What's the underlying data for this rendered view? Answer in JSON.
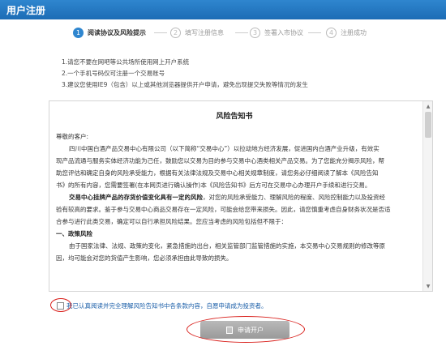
{
  "window": {
    "title": "用户注册"
  },
  "steps": [
    {
      "num": "1",
      "label": "阅读协议及风险提示",
      "active": true
    },
    {
      "num": "2",
      "label": "填写注册信息",
      "active": false
    },
    {
      "num": "3",
      "label": "签署入市协议",
      "active": false
    },
    {
      "num": "4",
      "label": "注册成功",
      "active": false
    }
  ],
  "notes": [
    "1.请您不要在网吧等公共场所使用网上开户系统",
    "2.一个手机号码仅可注册一个交易账号",
    "3.建议您使用IE9（包含）以上或其他浏览器提供开户申请，避免出现提交失败等情况的发生"
  ],
  "document": {
    "title": "风险告知书",
    "greeting": "尊敬的客户:",
    "p1_a": "四川中国白酒产品交易中心有限公司（以下简称“交易中心”）以拉动地方经济发展，促进国内白酒产业升级，有效实",
    "p1_b": "现产品流通与服务实体经济功能为己任，鼓励您以交易为目的参与交易中心酒类相关产品交易。为了您能充分揭示风险，帮",
    "p1_c": "助您评估和确定自身的风险承受能力，根据有关法律法规及交易中心相关规章制度，请您务必仔细阅读了解本《风险告知",
    "p1_d": "书》的所有内容，您需要签署(在本网页进行确认操作)本《风险告知书》后方可在交易中心办理开户手续和进行交易。",
    "p2_bold": "交易中心挂牌产品的存货价值变化具有一定的风险",
    "p2_a": "，对您的风险承受能力、理解风险的程度、风险控制能力以及投资经",
    "p2_b": "验有较高的要求。鉴于参与交易中心商品交易存在一定风险，可能会给您带来损失。因此，请您慎重考虑自身财务状况是否适",
    "p2_c": "合参与进行此类交易，确定可以自行承担风险结果。您应当考虑的风险包括但不限于：",
    "section1": "一、政策风险",
    "p3_a": "由于国家法律、法规、政策的变化，紧急措施的出台，相关监管部门监管措施的实施，本交易中心交易规则的修改等原",
    "p3_b": "因，均可能会对您的货值产生影响，您必须承担由此导致的损失。"
  },
  "agree": {
    "text": "我已认真阅读并完全理解风险告知书中各条款内容，自愿申请成为投资者。"
  },
  "apply_button": {
    "label": "申请开户"
  },
  "colors": {
    "accent": "#2f86cf",
    "annotation": "#d9201c",
    "button_disabled": "#a8a8a8"
  }
}
